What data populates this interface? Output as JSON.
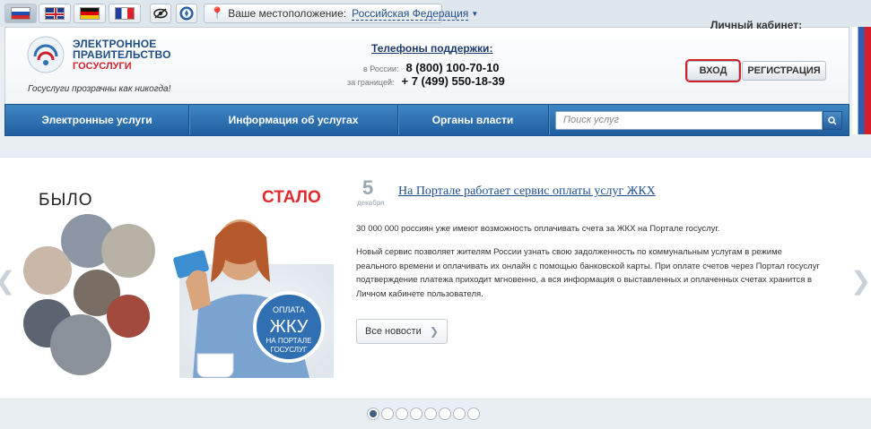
{
  "languages": [
    {
      "code": "ru",
      "active": true
    },
    {
      "code": "en",
      "active": false
    },
    {
      "code": "de",
      "active": false
    },
    {
      "code": "fr",
      "active": false
    }
  ],
  "toolbar": {
    "accessibility_icon": "eye-icon",
    "compass_icon": "compass-icon"
  },
  "location": {
    "label": "Ваше местоположение:",
    "value": "Российская Федерация"
  },
  "logo": {
    "line1": "ЭЛЕКТРОННОЕ",
    "line2": "ПРАВИТЕЛЬСТВО",
    "line3": "ГОСУСЛУГИ",
    "slogan": "Госуслуги прозрачны как никогда!"
  },
  "support": {
    "title": "Телефоны поддержки:",
    "rows": [
      {
        "label": "в России:",
        "number": "8 (800) 100-70-10"
      },
      {
        "label": "за границей:",
        "number": "+ 7 (499) 550-18-39"
      }
    ]
  },
  "cabinet": {
    "title": "Личный кабинет:",
    "login_label": "ВХОД",
    "register_label": "РЕГИСТРАЦИЯ"
  },
  "nav": {
    "items": [
      "Электронные услуги",
      "Информация об услугах",
      "Органы власти"
    ],
    "search_placeholder": "Поиск услуг"
  },
  "promo": {
    "before_label": "БЫЛО",
    "after_label": "СТАЛО",
    "badge_lines": [
      "ОПЛАТА",
      "ЖКУ",
      "НА ПОРТАЛЕ",
      "ГОСУСЛУГ"
    ]
  },
  "news": {
    "day": "5",
    "month": "декабря",
    "title": "На Портале работает сервис оплаты услуг ЖКХ",
    "paragraphs": [
      "30 000 000 россиян уже имеют возможность оплачивать счета за ЖКХ на Портале госуслуг.",
      "Новый сервис позволяет жителям России узнать свою задолженность по коммунальным услугам в режиме реального времени и оплачивать их онлайн с помощью банковской карты. При оплате счетов через Портал госуслуг подтверждение платежа приходит мгновенно, а вся информация о выставленных и оплаченных счетах хранится в Личном кабинете пользователя."
    ],
    "all_news_label": "Все новости"
  },
  "slider": {
    "total": 8,
    "active_index": 0
  },
  "colors": {
    "brand_blue": "#1f5e9f",
    "brand_red": "#d21f2b",
    "link": "#1f4f8e"
  }
}
